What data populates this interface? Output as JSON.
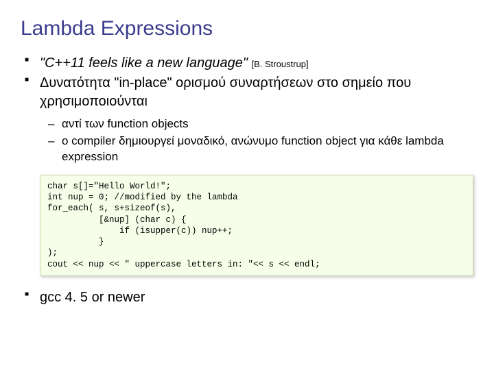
{
  "title": "Lambda Expressions",
  "bullets": {
    "b1_quote": "\"C++11 feels like a new language\"",
    "b1_attrib": "[B. Stroustrup]",
    "b2": "Δυνατότητα \"in-place\" ορισμού συναρτήσεων στο σημείο που χρησιμοποιούνται",
    "b3": "gcc 4. 5 or newer"
  },
  "sub": {
    "s1": "αντί των function objects",
    "s2": "ο compiler δημιουργεί μοναδικό, ανώνυμο function object για κάθε lambda expression"
  },
  "code": "char s[]=\"Hello World!\";\nint nup = 0; //modified by the lambda\nfor_each( s, s+sizeof(s),\n          [&nup] (char c) {\n              if (isupper(c)) nup++;\n          }\n);\ncout << nup << \" uppercase letters in: \"<< s << endl;"
}
